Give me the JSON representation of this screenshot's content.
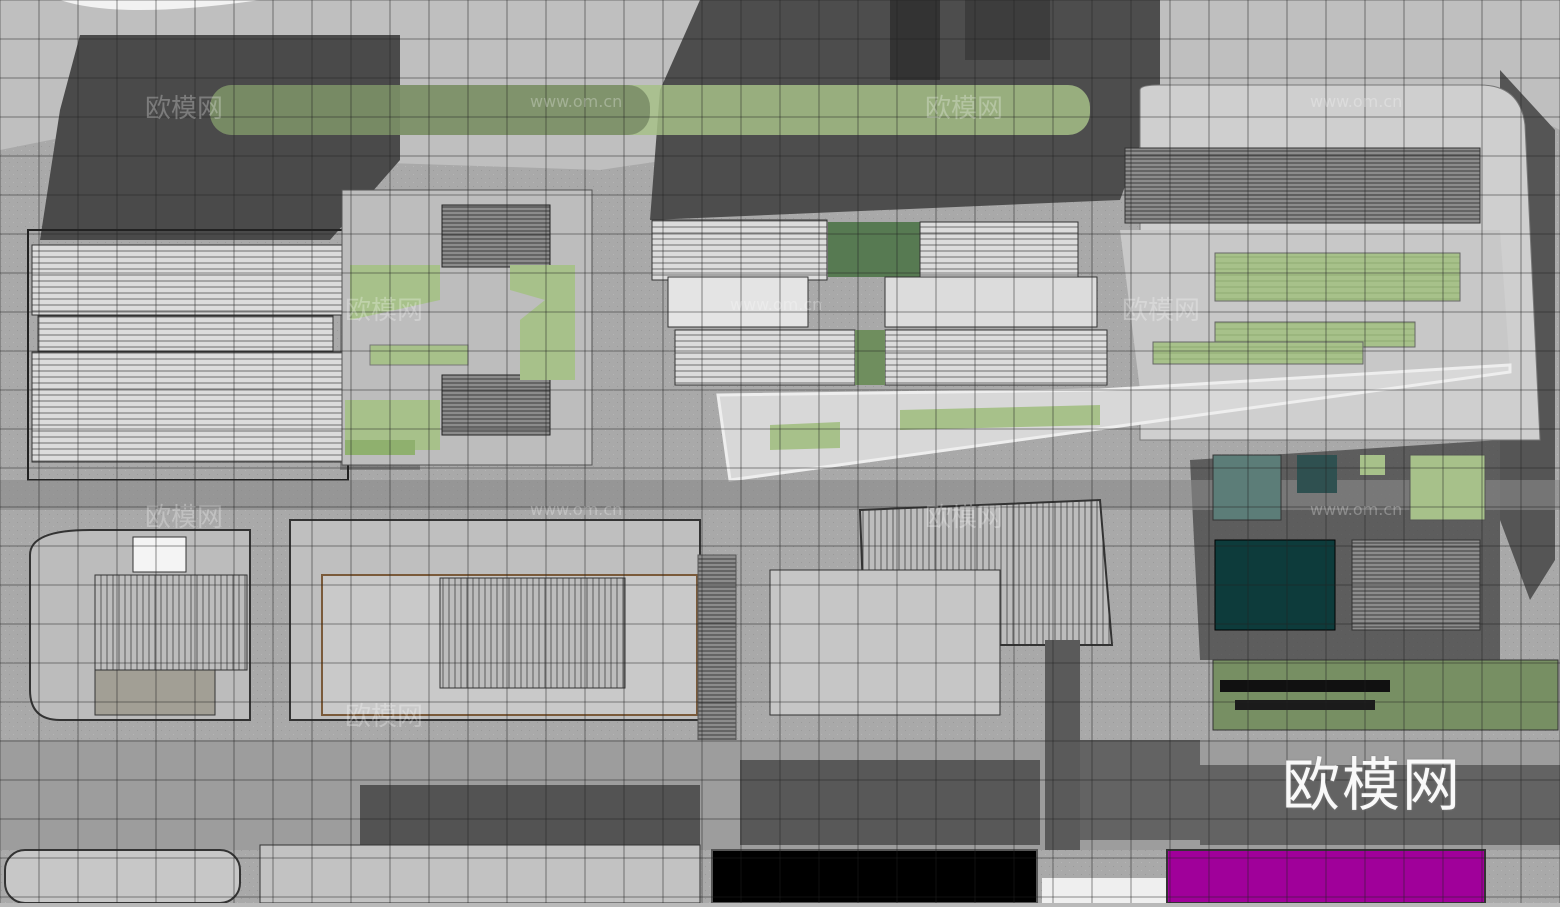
{
  "watermarks": {
    "brand_cn": "欧模网",
    "url": "www.om.cn"
  },
  "colors": {
    "background": "#b9b9b9",
    "pavement": "#a8a8a8",
    "pavement_light": "#c4c4c4",
    "shadow": "#4c4c4c",
    "shadow_dark": "#3a3a3a",
    "roof": "#d6d6d6",
    "roof_line": "#7a7a7a",
    "lawn": "#a7c18a",
    "lawn_dark": "#7f9a66",
    "water": "#0d3b3b",
    "black_block": "#000000",
    "magenta_block": "#a0009a",
    "grid": "#222222"
  }
}
